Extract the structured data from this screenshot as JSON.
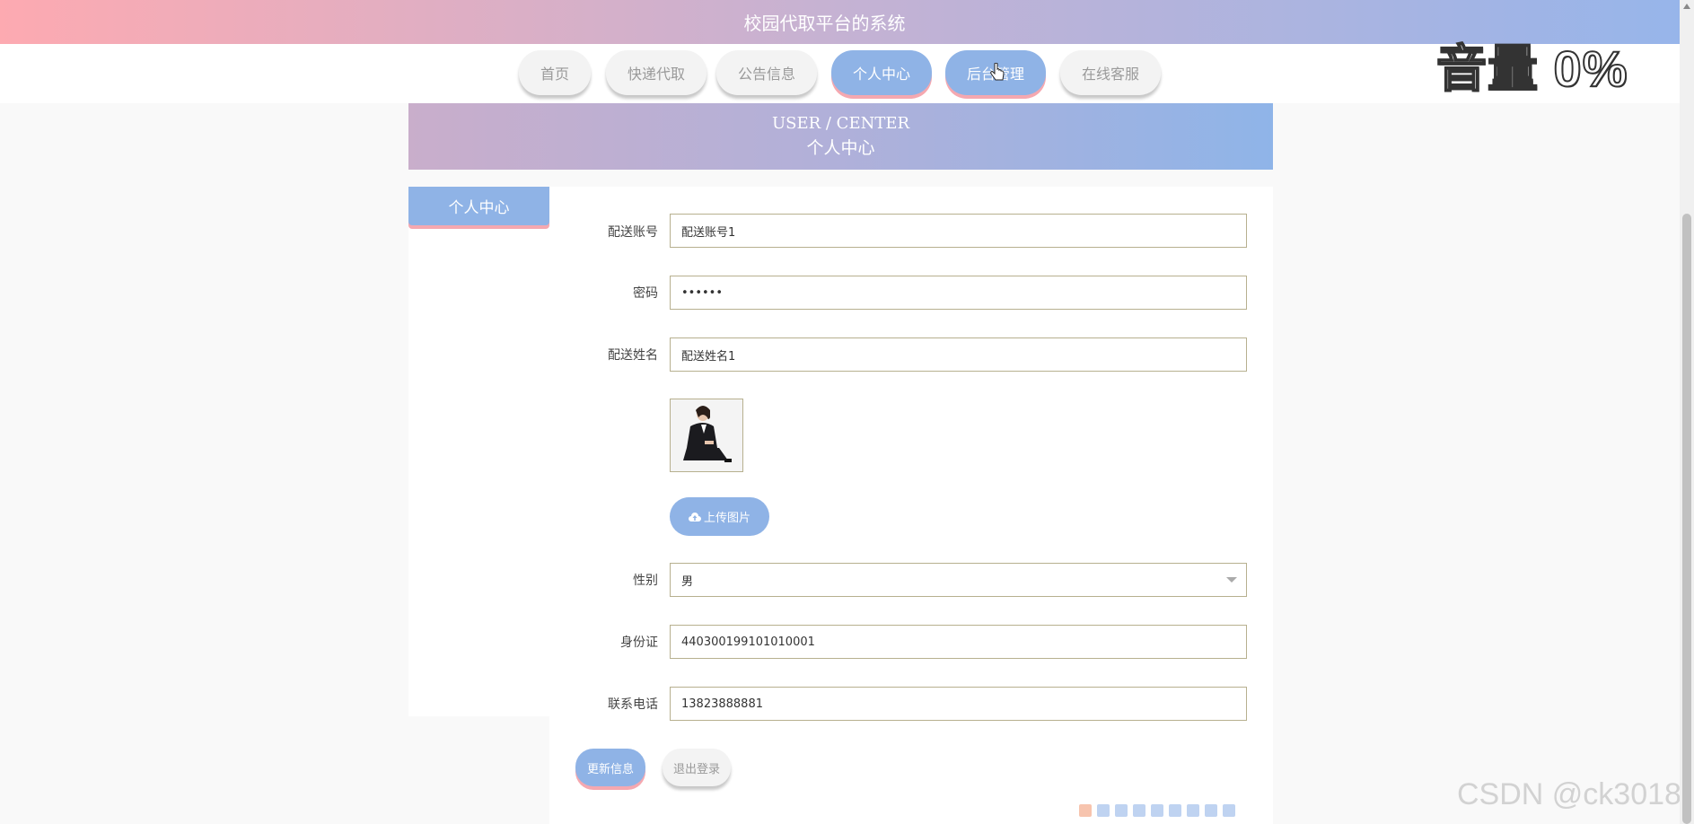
{
  "header": {
    "title": "校园代取平台的系统"
  },
  "nav": {
    "items": [
      "首页",
      "快递代取",
      "公告信息",
      "个人中心",
      "后台管理",
      "在线客服"
    ],
    "active": "个人中心"
  },
  "overlay": {
    "volume": "音量 0%"
  },
  "banner": {
    "en": "USER / CENTER",
    "cn": "个人中心"
  },
  "sidebar": {
    "items": [
      "个人中心"
    ]
  },
  "form": {
    "account_label": "配送账号",
    "account_value": "配送账号1",
    "password_label": "密码",
    "password_value": "••••••",
    "name_label": "配送姓名",
    "name_value": "配送姓名1",
    "upload_label": "上传图片",
    "gender_label": "性别",
    "gender_value": "男",
    "idcard_label": "身份证",
    "idcard_value": "440300199101010001",
    "phone_label": "联系电话",
    "phone_value": "13823888881"
  },
  "actions": {
    "update": "更新信息",
    "logout": "退出登录"
  },
  "watermark": "CSDN @ck3018",
  "colors": {
    "accent": "#8fb3e6",
    "accent_shadow": "#f5a8b0",
    "header_start": "#fdaab1",
    "header_end": "#97b5ea"
  }
}
